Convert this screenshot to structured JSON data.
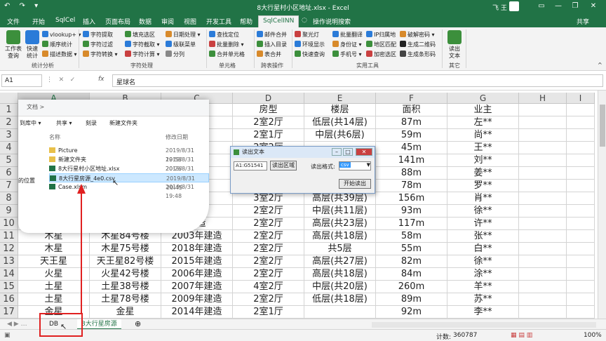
{
  "window": {
    "title": "8大行星村小区地址.xlsx - Excel",
    "user": "飞 王",
    "quick_access": "↶ ↷ ▾"
  },
  "tabs": [
    "文件",
    "开始",
    "SqlCel",
    "插入",
    "页面布局",
    "数据",
    "审阅",
    "视图",
    "开发工具",
    "帮助",
    "SqlCelINN",
    "操作说明搜索",
    "共享"
  ],
  "ribbon": {
    "groups": [
      "统计分析",
      "字符处理",
      "单元格",
      "跨表操作",
      "实用工具",
      "其它"
    ],
    "big_buttons": [
      {
        "label1": "工作表",
        "label2": "查询"
      },
      {
        "label1": "快速",
        "label2": "统计"
      },
      {
        "label1": "读出",
        "label2": "文本"
      }
    ],
    "items": [
      "vlookup+",
      "顺序统计",
      "描述数据",
      "字符提取",
      "字符过滤",
      "字符转换",
      "填充选区",
      "字符截取",
      "字符计算",
      "日期处理",
      "级联菜单",
      "分列",
      "查找定位",
      "批量删除",
      "合并单元格",
      "邮件合并",
      "插入目录",
      "表合并",
      "聚光灯",
      "环境显示",
      "快速查询",
      "批量翻译",
      "身份证",
      "手机号",
      "IP归属地",
      "地区匹配",
      "加密选区",
      "破解密码",
      "生成二维码",
      "生成条形码"
    ]
  },
  "formula_bar": {
    "name_box": "A1",
    "fx": "fx",
    "content": "星球名"
  },
  "columns": [
    "A",
    "B",
    "C",
    "D",
    "E",
    "F",
    "G",
    "H",
    "I"
  ],
  "row_numbers": [
    "1",
    "2",
    "3",
    "4",
    "5",
    "6",
    "7",
    "8",
    "9",
    "10",
    "11",
    "12",
    "13",
    "14",
    "15",
    "16",
    "17"
  ],
  "table_rows": [
    [
      "",
      "",
      "日期",
      "房型",
      "楼层",
      "面积",
      "业主"
    ],
    [
      "",
      "",
      "建造",
      "2室2厅",
      "低层(共14层)",
      "87m",
      "左**"
    ],
    [
      "",
      "",
      "建造",
      "2室1厅",
      "中层(共6层)",
      "59m",
      "尚**"
    ],
    [
      "",
      "",
      "建造",
      "2室2厅",
      "",
      "45m",
      "王**"
    ],
    [
      "",
      "",
      "建造",
      "",
      "",
      "141m",
      "刘**"
    ],
    [
      "",
      "",
      "建造",
      "",
      "",
      "88m",
      "姜**"
    ],
    [
      "",
      "",
      "建造",
      "2室1厅",
      "",
      "78m",
      "罗**"
    ],
    [
      "",
      "",
      "建造",
      "3室2厅",
      "高层(共39层)",
      "156m",
      "肖**"
    ],
    [
      "",
      "",
      "建造",
      "2室2厅",
      "中层(共11层)",
      "93m",
      "徐**"
    ],
    [
      "",
      "",
      "建造",
      "2室2厅",
      "高层(共23层)",
      "117m",
      "许**"
    ],
    [
      "木星",
      "木星84号楼",
      "2003年建造",
      "2室2厅",
      "高层(共18层)",
      "58m",
      "张**"
    ],
    [
      "木星",
      "木星75号楼",
      "2018年建造",
      "2室2厅",
      "共5层",
      "55m",
      "白**"
    ],
    [
      "天王星",
      "天王星82号楼",
      "2015年建造",
      "2室2厅",
      "高层(共27层)",
      "82m",
      "徐**"
    ],
    [
      "火星",
      "火星42号楼",
      "2006年建造",
      "2室2厅",
      "高层(共18层)",
      "84m",
      "涂**"
    ],
    [
      "土星",
      "土星38号楼",
      "2007年建造",
      "4室2厅",
      "中层(共20层)",
      "260m",
      "羊**"
    ],
    [
      "土星",
      "土星78号楼",
      "2009年建造",
      "2室2厅",
      "低层(共18层)",
      "89m",
      "苏**"
    ],
    [
      "金星",
      "金星",
      "2014年建造",
      "2室1厅",
      "",
      "92m",
      "李**"
    ]
  ],
  "sheets": {
    "tabs": [
      "DB",
      "8大行星房源"
    ],
    "active": "8大行星房源",
    "add": "⊕"
  },
  "status": {
    "count_label": "计数:",
    "count_value": "360787",
    "zoom": "100%"
  },
  "explorer": {
    "breadcrumb": "文档 > ",
    "toolbar": [
      "到库中 ▾",
      "共享 ▾",
      "刻录",
      "新建文件夹"
    ],
    "headers": [
      "名称",
      "修改日期"
    ],
    "left_label": "的位置",
    "files": [
      {
        "name": "Picture",
        "date": "2019/8/31 19:58",
        "kind": "folder"
      },
      {
        "name": "新建文件夹",
        "date": "2019/8/31 20:26",
        "kind": "folder"
      },
      {
        "name": "8大行星村小区地址.xlsx",
        "date": "2019/8/31 20:26",
        "kind": "xlsx"
      },
      {
        "name": "8大行星房源_4e0.csv",
        "date": "2019/8/31 20:45",
        "kind": "csv"
      },
      {
        "name": "Case.xlsm",
        "date": "2019/8/31 19:48",
        "kind": "xlsx"
      }
    ]
  },
  "dialog": {
    "title": "读出文本",
    "range_value": "A1:G51541",
    "read_range_button": "读出区域",
    "format_label": "读出格式:",
    "format_value": "csv",
    "start_button": "开始读出"
  },
  "colors": {
    "excel_green": "#217346",
    "annotation_red": "#e02020"
  }
}
